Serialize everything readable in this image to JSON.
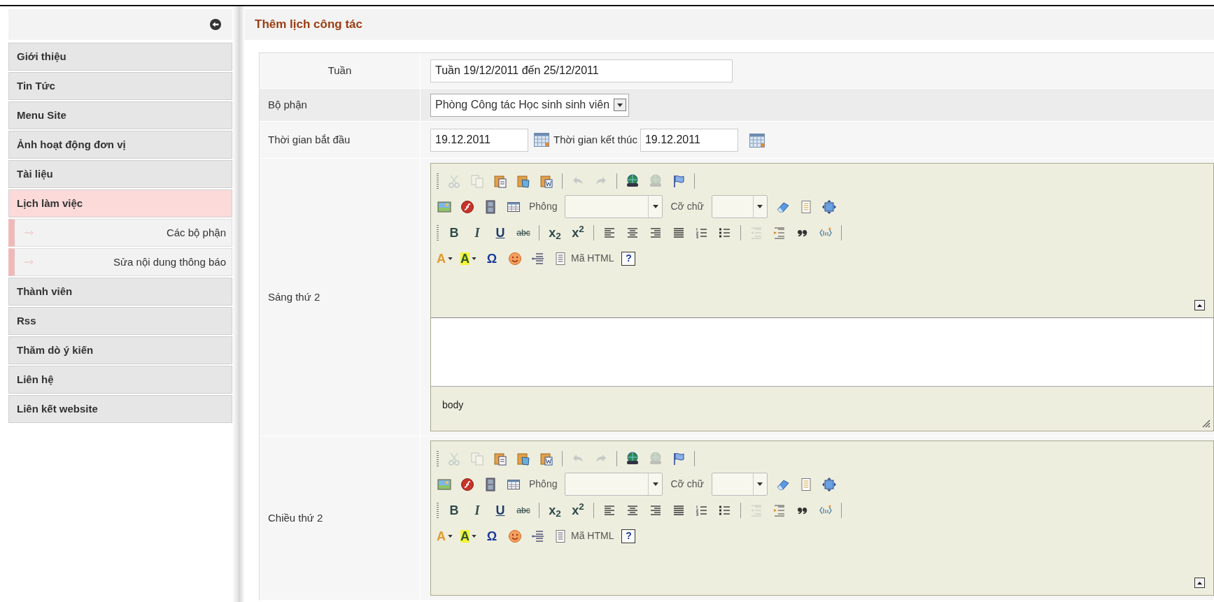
{
  "sidebar": {
    "items": [
      {
        "label": "Giới thiệu",
        "selected": false
      },
      {
        "label": "Tin Tức",
        "selected": false
      },
      {
        "label": "Menu Site",
        "selected": false
      },
      {
        "label": "Ảnh hoạt động đơn vị",
        "selected": false
      },
      {
        "label": "Tài liệu",
        "selected": false
      },
      {
        "label": "Lịch làm việc",
        "selected": true,
        "children": [
          {
            "label": "Các bộ phận"
          },
          {
            "label": "Sửa nội dung thông báo"
          }
        ]
      },
      {
        "label": "Thành viên",
        "selected": false
      },
      {
        "label": "Rss",
        "selected": false
      },
      {
        "label": "Thăm dò ý kiến",
        "selected": false
      },
      {
        "label": "Liên hệ",
        "selected": false
      },
      {
        "label": "Liên kết website",
        "selected": false
      }
    ]
  },
  "page_title": "Thêm lịch công tác",
  "form": {
    "rows": [
      {
        "kind": "text",
        "label": "Tuần",
        "label_centered": true,
        "value": "Tuần 19/12/2011 đến 25/12/2011"
      },
      {
        "kind": "select",
        "label": "Bộ phận",
        "label_centered": false,
        "value": "Phòng Công tác Học sinh sinh viên"
      },
      {
        "kind": "daterange",
        "label": "Thời gian bắt đầu",
        "label_centered": false,
        "start": "19.12.2011",
        "end_label": "Thời gian kết thúc",
        "end": "19.12.2011"
      },
      {
        "kind": "editor",
        "label": "Sáng thứ 2",
        "label_centered": false,
        "editor": {
          "toolbar": [
            [
              {
                "kind": "grip"
              },
              {
                "kind": "cut",
                "disabled": true
              },
              {
                "kind": "copy",
                "disabled": true
              },
              {
                "kind": "paste",
                "disabled": false
              },
              {
                "kind": "pastetext",
                "disabled": false
              },
              {
                "kind": "pasteword",
                "disabled": false
              },
              {
                "kind": "sep"
              },
              {
                "kind": "undo",
                "disabled": true
              },
              {
                "kind": "redo",
                "disabled": true
              },
              {
                "kind": "sep"
              },
              {
                "kind": "link",
                "disabled": false
              },
              {
                "kind": "unlink",
                "disabled": true
              },
              {
                "kind": "anchor",
                "disabled": false
              },
              {
                "kind": "sep"
              }
            ],
            [
              {
                "kind": "image",
                "disabled": false
              },
              {
                "kind": "flash",
                "disabled": false
              },
              {
                "kind": "media",
                "disabled": false
              },
              {
                "kind": "table",
                "disabled": false
              },
              {
                "kind": "label",
                "text": "Phông"
              },
              {
                "kind": "fontcombo"
              },
              {
                "kind": "label",
                "text": "Cỡ chữ"
              },
              {
                "kind": "sizecombo"
              },
              {
                "kind": "eraser",
                "disabled": false
              },
              {
                "kind": "template",
                "disabled": false
              },
              {
                "kind": "maximize",
                "disabled": false
              }
            ],
            [
              {
                "kind": "grip"
              },
              {
                "kind": "bold",
                "glyph": "B",
                "disabled": false
              },
              {
                "kind": "italic",
                "glyph": "I",
                "disabled": false
              },
              {
                "kind": "underline",
                "glyph": "U",
                "disabled": false
              },
              {
                "kind": "strike",
                "glyph": "abc",
                "disabled": false
              },
              {
                "kind": "sep"
              },
              {
                "kind": "script",
                "glyph": "x$_{2}$",
                "disabled": false
              },
              {
                "kind": "script",
                "glyph": "x$^{2}$",
                "disabled": false
              },
              {
                "kind": "sep"
              },
              {
                "kind": "alignleft",
                "disabled": false
              },
              {
                "kind": "aligncenter",
                "disabled": false
              },
              {
                "kind": "alignright",
                "disabled": false
              },
              {
                "kind": "justify",
                "disabled": false
              },
              {
                "kind": "ol",
                "disabled": false
              },
              {
                "kind": "ul",
                "disabled": false
              },
              {
                "kind": "sep"
              },
              {
                "kind": "outdent",
                "disabled": true
              },
              {
                "kind": "indent",
                "disabled": false
              },
              {
                "kind": "quote",
                "disabled": false
              },
              {
                "kind": "div",
                "disabled": false
              },
              {
                "kind": "sep"
              }
            ],
            [
              {
                "kind": "textcolor",
                "glyph": "A",
                "disabled": false
              },
              {
                "kind": "bgcolor",
                "glyph": "A",
                "disabled": false
              },
              {
                "kind": "symbol",
                "glyph": "Ω",
                "disabled": false
              },
              {
                "kind": "smiley",
                "disabled": false
              },
              {
                "kind": "pagebreak",
                "disabled": false
              },
              {
                "kind": "source",
                "text": "Mã HTML",
                "disabled": false
              },
              {
                "kind": "help",
                "glyph": "?",
                "disabled": false
              }
            ]
          ],
          "status": "body"
        }
      },
      {
        "kind": "editor",
        "label": "Chiều thứ 2",
        "label_centered": false,
        "editor": {
          "toolbar": [
            [
              {
                "kind": "grip"
              },
              {
                "kind": "cut",
                "disabled": true
              },
              {
                "kind": "copy",
                "disabled": true
              },
              {
                "kind": "paste",
                "disabled": false
              },
              {
                "kind": "pastetext",
                "disabled": false
              },
              {
                "kind": "pasteword",
                "disabled": false
              },
              {
                "kind": "sep"
              },
              {
                "kind": "undo",
                "disabled": true
              },
              {
                "kind": "redo",
                "disabled": true
              },
              {
                "kind": "sep"
              },
              {
                "kind": "link",
                "disabled": false
              },
              {
                "kind": "unlink",
                "disabled": true
              },
              {
                "kind": "anchor",
                "disabled": false
              },
              {
                "kind": "sep"
              }
            ],
            [
              {
                "kind": "image",
                "disabled": false
              },
              {
                "kind": "flash",
                "disabled": false
              },
              {
                "kind": "media",
                "disabled": false
              },
              {
                "kind": "table",
                "disabled": false
              },
              {
                "kind": "label",
                "text": "Phông"
              },
              {
                "kind": "fontcombo"
              },
              {
                "kind": "label",
                "text": "Cỡ chữ"
              },
              {
                "kind": "sizecombo"
              },
              {
                "kind": "eraser",
                "disabled": false
              },
              {
                "kind": "template",
                "disabled": false
              },
              {
                "kind": "maximize",
                "disabled": false
              }
            ],
            [
              {
                "kind": "grip"
              },
              {
                "kind": "bold",
                "glyph": "B",
                "disabled": false
              },
              {
                "kind": "italic",
                "glyph": "I",
                "disabled": false
              },
              {
                "kind": "underline",
                "glyph": "U",
                "disabled": false
              },
              {
                "kind": "strike",
                "glyph": "abc",
                "disabled": false
              },
              {
                "kind": "sep"
              },
              {
                "kind": "script",
                "glyph": "x$_{2}$",
                "disabled": false
              },
              {
                "kind": "script",
                "glyph": "x$^{2}$",
                "disabled": false
              },
              {
                "kind": "sep"
              },
              {
                "kind": "alignleft",
                "disabled": false
              },
              {
                "kind": "aligncenter",
                "disabled": false
              },
              {
                "kind": "alignright",
                "disabled": false
              },
              {
                "kind": "justify",
                "disabled": false
              },
              {
                "kind": "ol",
                "disabled": false
              },
              {
                "kind": "ul",
                "disabled": false
              },
              {
                "kind": "sep"
              },
              {
                "kind": "outdent",
                "disabled": true
              },
              {
                "kind": "indent",
                "disabled": false
              },
              {
                "kind": "quote",
                "disabled": false
              },
              {
                "kind": "div",
                "disabled": false
              },
              {
                "kind": "sep"
              }
            ],
            [
              {
                "kind": "textcolor",
                "glyph": "A",
                "disabled": false
              },
              {
                "kind": "bgcolor",
                "glyph": "A",
                "disabled": false
              },
              {
                "kind": "symbol",
                "glyph": "Ω",
                "disabled": false
              },
              {
                "kind": "smiley",
                "disabled": false
              },
              {
                "kind": "pagebreak",
                "disabled": false
              },
              {
                "kind": "source",
                "text": "Mã HTML",
                "disabled": false
              },
              {
                "kind": "help",
                "glyph": "?",
                "disabled": false
              }
            ]
          ]
        }
      }
    ]
  }
}
